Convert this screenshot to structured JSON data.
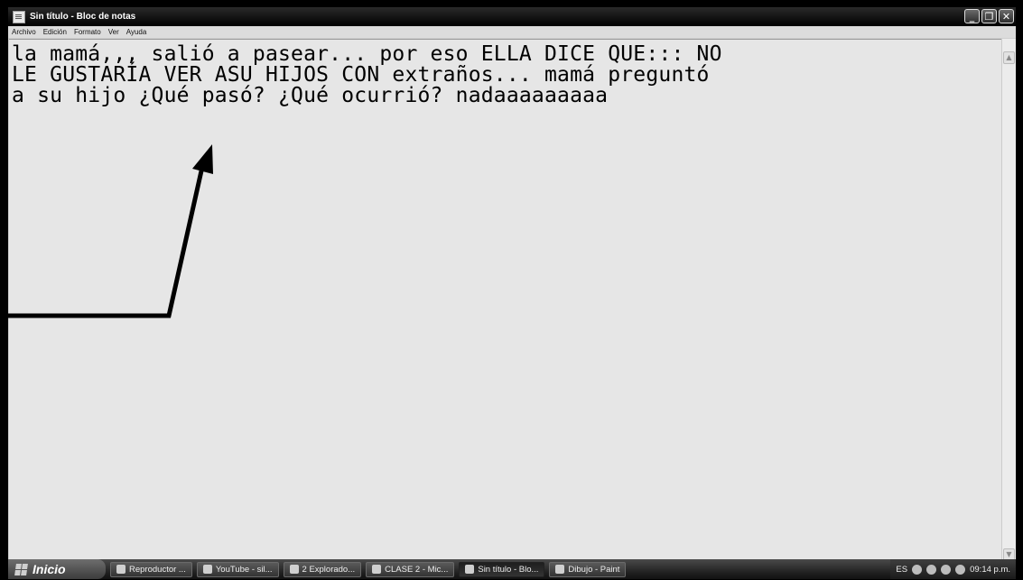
{
  "window": {
    "title": "Sin título - Bloc de notas",
    "controls": {
      "minimize": "_",
      "restore": "❐",
      "close": "✕"
    }
  },
  "menu": [
    "Archivo",
    "Edición",
    "Formato",
    "Ver",
    "Ayuda"
  ],
  "editor": {
    "text": "la mamá,,, salió a pasear... por eso ELLA DICE QUE::: NO\nLE GUSTARÍA VER ASU HIJOS CON extraños... mamá preguntó\na su hijo ¿Qué pasó? ¿Qué ocurrió? nadaaaaaaaaa"
  },
  "taskbar": {
    "start_label": "Inicio",
    "tasks": [
      {
        "label": "Reproductor ...",
        "icon": "media-player-icon"
      },
      {
        "label": "YouTube - sil...",
        "icon": "browser-icon"
      },
      {
        "label": "2 Explorado...",
        "icon": "folder-icon"
      },
      {
        "label": "CLASE 2 - Mic...",
        "icon": "powerpoint-icon"
      },
      {
        "label": "Sin título - Blo...",
        "icon": "notepad-icon",
        "active": true
      },
      {
        "label": "Dibujo - Paint",
        "icon": "paint-icon"
      }
    ],
    "tray": {
      "language": "ES",
      "clock": "09:14 p.m."
    }
  },
  "colors": {
    "frame": "#000000",
    "editor_bg": "#e6e6e6",
    "titlebar": "#111111"
  }
}
